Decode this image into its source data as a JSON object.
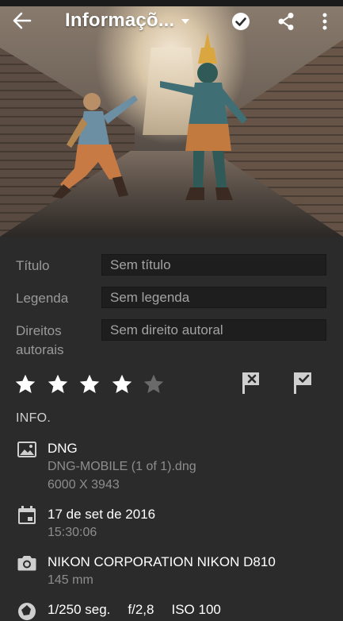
{
  "header": {
    "title": "Informaçõ...",
    "icons": {
      "back": "arrow-left-icon",
      "dropdown": "caret-down-icon",
      "apply": "check-circle-icon",
      "share": "share-icon",
      "more": "more-vertical-icon"
    }
  },
  "fields": [
    {
      "label": "Título",
      "placeholder": "Sem título"
    },
    {
      "label": "Legenda",
      "placeholder": "Sem legenda"
    },
    {
      "label": "Direitos autorais",
      "placeholder": "Sem direito autoral"
    }
  ],
  "rating": {
    "value": 4,
    "max": 5,
    "star_color": "#ffffff",
    "empty_color": "#6a6a6a"
  },
  "flags": {
    "reject": "flag-reject-icon",
    "pick": "flag-pick-icon"
  },
  "info": {
    "section_title": "INFO.",
    "file": {
      "type": "DNG",
      "name": "DNG-MOBILE (1 of 1).dng",
      "dimensions": "6000 X 3943"
    },
    "date": {
      "date": "17 de set de 2016",
      "time": "15:30:06"
    },
    "camera": {
      "model": "NIKON CORPORATION NIKON D810",
      "focal_length": "145 mm"
    },
    "exposure": {
      "shutter": "1/250 seg.",
      "aperture": "f/2,8",
      "iso": "ISO 100"
    }
  }
}
